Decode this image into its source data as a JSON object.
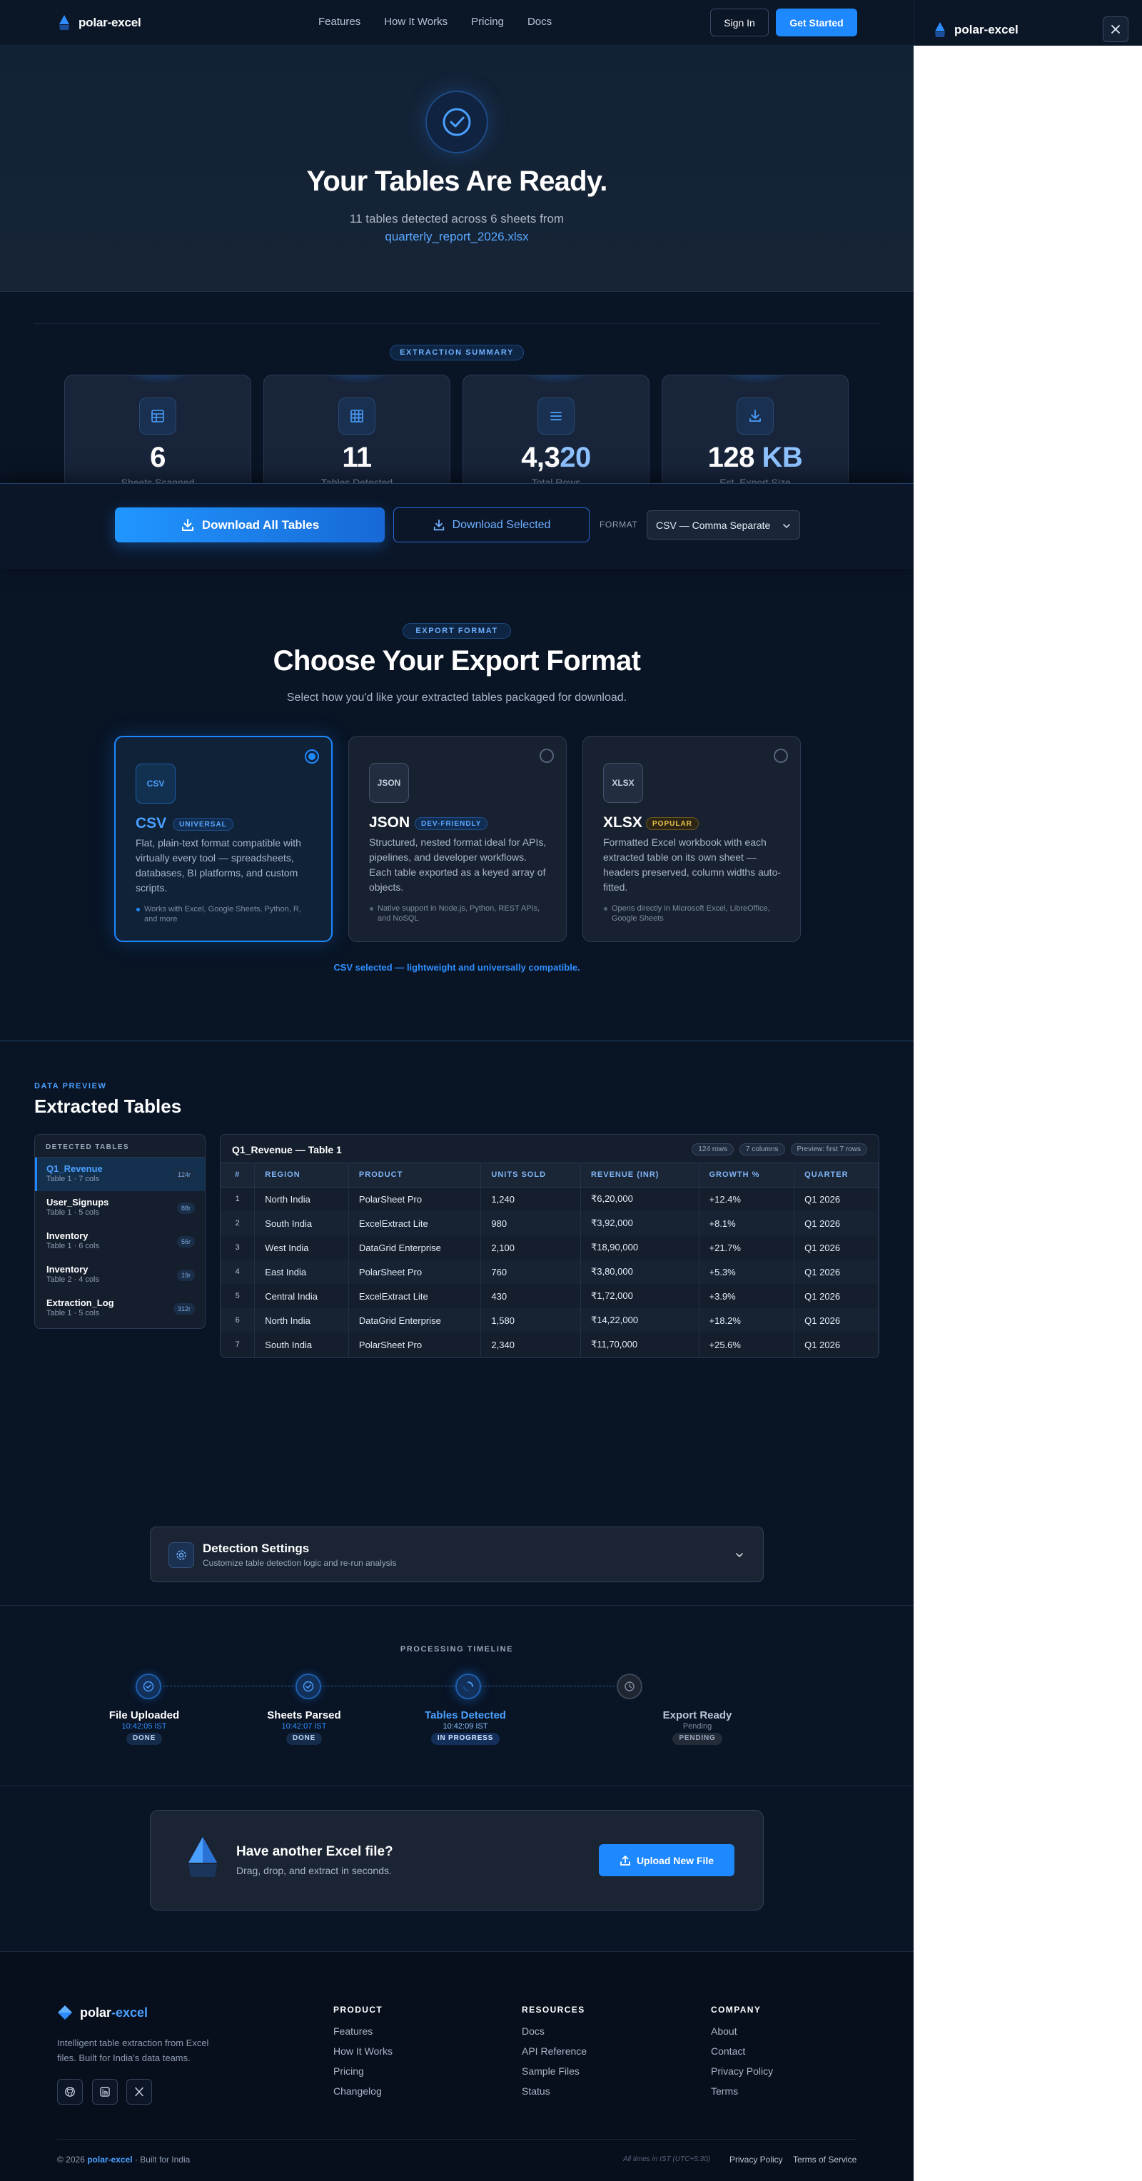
{
  "brand": {
    "name": "polar-excel"
  },
  "nav": {
    "links": [
      "Features",
      "How It Works",
      "Pricing",
      "Docs"
    ],
    "sign_in": "Sign In",
    "get_started": "Get Started"
  },
  "hero": {
    "title": "Your Tables Are Ready.",
    "subtitle": "11 tables detected across 6 sheets from",
    "filename": "quarterly_report_2026.xlsx"
  },
  "summary": {
    "pill": "EXTRACTION SUMMARY",
    "stats": [
      {
        "value": "6",
        "label": "Sheets Scanned",
        "icon": "sheet-icon"
      },
      {
        "value": "11",
        "label": "Tables Detected",
        "icon": "grid-icon"
      },
      {
        "value_main": "4,3",
        "value_accent": "20",
        "label": "Total Rows",
        "icon": "rows-icon"
      },
      {
        "value_main": "128",
        "value_accent": "KB",
        "label": "Est. Export Size",
        "icon": "download-icon"
      }
    ]
  },
  "actions": {
    "download_all": "Download All Tables",
    "download_selected": "Download Selected",
    "format_label": "FORMAT",
    "format_value": "CSV — Comma Separate"
  },
  "export_format": {
    "pill": "EXPORT FORMAT",
    "title": "Choose Your Export Format",
    "subtitle": "Select how you'd like your extracted tables packaged for download.",
    "cards": [
      {
        "badge": "CSV",
        "name": "CSV",
        "tag": "UNIVERSAL",
        "desc": "Flat, plain-text format compatible with virtually every tool — spreadsheets, databases, BI platforms, and custom scripts.",
        "note": "Works with Excel, Google Sheets, Python, R, and more",
        "selected": true
      },
      {
        "badge": "JSON",
        "name": "JSON",
        "tag": "DEV-FRIENDLY",
        "desc": "Structured, nested format ideal for APIs, pipelines, and developer workflows. Each table exported as a keyed array of objects.",
        "note": "Native support in Node.js, Python, REST APIs, and NoSQL",
        "selected": false
      },
      {
        "badge": "XLSX",
        "name": "XLSX",
        "tag": "POPULAR",
        "desc": "Formatted Excel workbook with each extracted table on its own sheet — headers preserved, column widths auto-fitted.",
        "note": "Opens directly in Microsoft Excel, LibreOffice, Google Sheets",
        "selected": false
      }
    ],
    "status": "CSV selected — lightweight and universally compatible."
  },
  "preview": {
    "eyebrow": "DATA PREVIEW",
    "title": "Extracted Tables",
    "list_title": "DETECTED TABLES",
    "tables": [
      {
        "name": "Q1_Revenue",
        "meta": "Table 1 · 7 cols",
        "count": "124r"
      },
      {
        "name": "User_Signups",
        "meta": "Table 1 · 5 cols",
        "count": "88r"
      },
      {
        "name": "Inventory",
        "meta": "Table 1 · 6 cols",
        "count": "56r"
      },
      {
        "name": "Inventory",
        "meta": "Table 2 · 4 cols",
        "count": "19r"
      },
      {
        "name": "Extraction_Log",
        "meta": "Table 1 · 5 cols",
        "count": "312r"
      }
    ],
    "table_title": "Q1_Revenue — Table 1",
    "chips": [
      "124 rows",
      "7 columns",
      "Preview: first 7 rows"
    ],
    "columns": [
      "#",
      "REGION",
      "PRODUCT",
      "UNITS SOLD",
      "REVENUE (INR)",
      "GROWTH %",
      "QUARTER"
    ],
    "rows": [
      [
        "1",
        "North India",
        "PolarSheet Pro",
        "1,240",
        "₹6,20,000",
        "+12.4%",
        "Q1 2026"
      ],
      [
        "2",
        "South India",
        "ExcelExtract Lite",
        "980",
        "₹3,92,000",
        "+8.1%",
        "Q1 2026"
      ],
      [
        "3",
        "West India",
        "DataGrid Enterprise",
        "2,100",
        "₹18,90,000",
        "+21.7%",
        "Q1 2026"
      ],
      [
        "4",
        "East India",
        "PolarSheet Pro",
        "760",
        "₹3,80,000",
        "+5.3%",
        "Q1 2026"
      ],
      [
        "5",
        "Central India",
        "ExcelExtract Lite",
        "430",
        "₹1,72,000",
        "+3.9%",
        "Q1 2026"
      ],
      [
        "6",
        "North India",
        "DataGrid Enterprise",
        "1,580",
        "₹14,22,000",
        "+18.2%",
        "Q1 2026"
      ],
      [
        "7",
        "South India",
        "PolarSheet Pro",
        "2,340",
        "₹11,70,000",
        "+25.6%",
        "Q1 2026"
      ]
    ]
  },
  "detection": {
    "title": "Detection Settings",
    "subtitle": "Customize table detection logic and re-run analysis"
  },
  "timeline": {
    "title": "PROCESSING TIMELINE",
    "steps": [
      {
        "name": "File Uploaded",
        "time": "10:42:05 IST",
        "status": "DONE"
      },
      {
        "name": "Sheets Parsed",
        "time": "10:42:07 IST",
        "status": "DONE"
      },
      {
        "name": "Tables Detected",
        "time": "10:42:09 IST",
        "status": "IN PROGRESS"
      },
      {
        "name": "Export Ready",
        "time": "Pending",
        "status": "PENDING"
      }
    ]
  },
  "cta": {
    "title": "Have another Excel file?",
    "subtitle": "Drag, drop, and extract in seconds.",
    "button": "Upload New File"
  },
  "footer": {
    "brand_main": "polar",
    "brand_accent": "-excel",
    "about": "Intelligent table extraction from Excel files. Built for India's data teams.",
    "columns": [
      {
        "title": "PRODUCT",
        "links": [
          "Features",
          "How It Works",
          "Pricing",
          "Changelog"
        ]
      },
      {
        "title": "RESOURCES",
        "links": [
          "Docs",
          "API Reference",
          "Sample Files",
          "Status"
        ]
      },
      {
        "title": "COMPANY",
        "links": [
          "About",
          "Contact",
          "Privacy Policy",
          "Terms"
        ]
      }
    ],
    "copyright_prefix": "© 2026",
    "copyright_brand": "polar-excel",
    "copyright_suffix": "· Built for India",
    "timezone": "All times in IST (UTC+5:30)",
    "privacy": "Privacy Policy",
    "terms": "Terms of Service"
  },
  "colors": {
    "accent": "#1e88ff",
    "background": "#091425",
    "panel": "#ffffff"
  }
}
